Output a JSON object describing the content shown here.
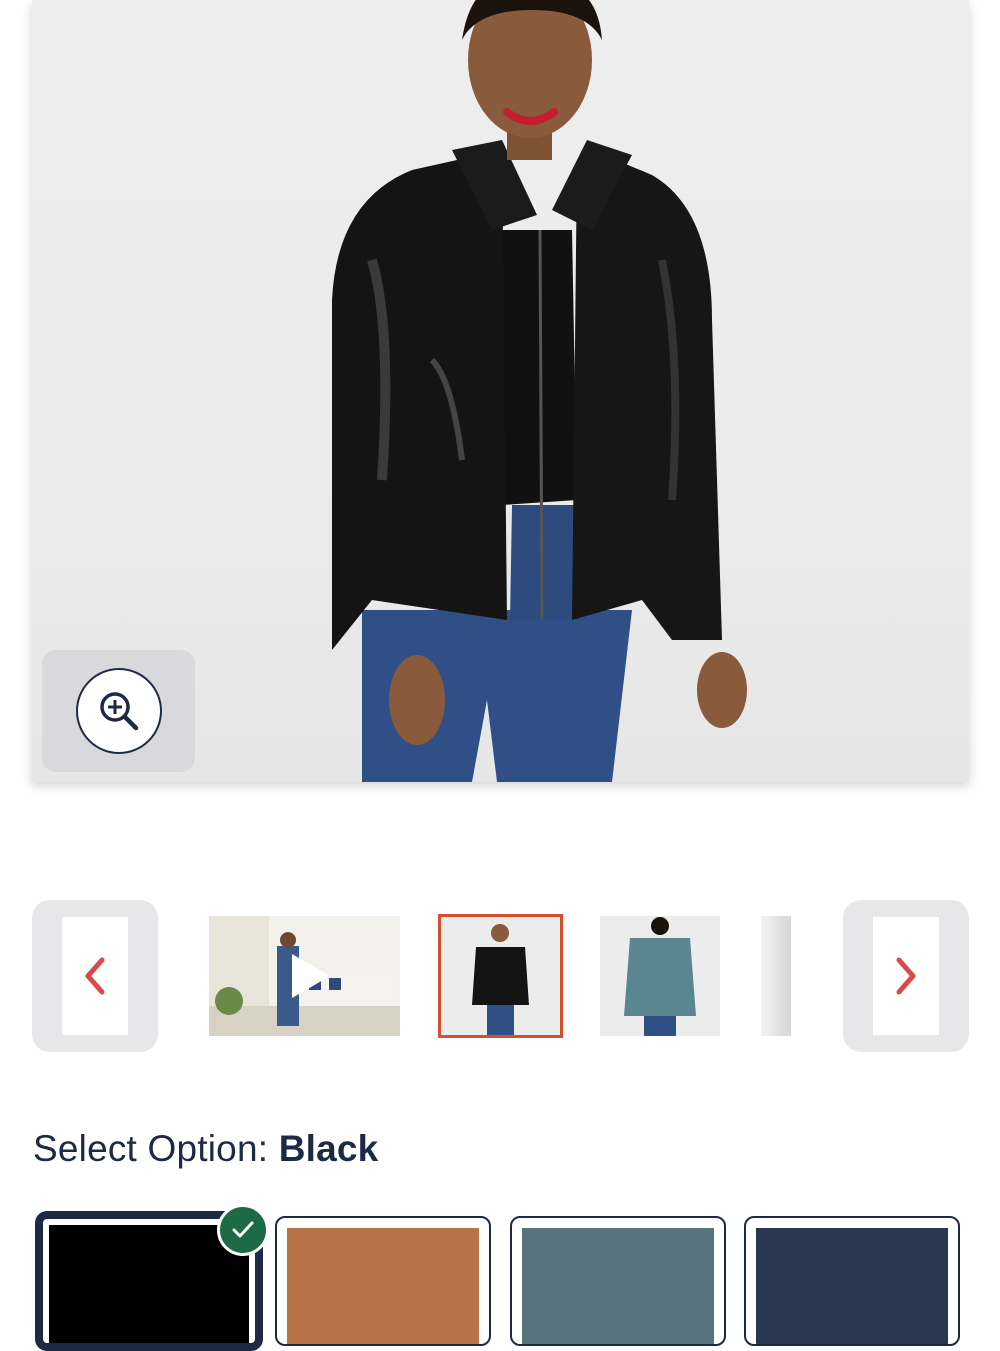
{
  "product_image": {
    "alt": "Woman wearing black leather zip jacket with jeans"
  },
  "zoom": {
    "icon": "zoom-in-icon"
  },
  "carousel": {
    "prev_icon": "chevron-left-icon",
    "next_icon": "chevron-right-icon",
    "accent": "#d94a4a",
    "thumbnails": [
      {
        "kind": "video",
        "icon": "play-icon"
      },
      {
        "kind": "image",
        "selected": true
      },
      {
        "kind": "image"
      },
      {
        "kind": "image"
      }
    ],
    "selected_border": "#d2502c"
  },
  "option": {
    "label": "Select Option:",
    "value": "Black"
  },
  "swatches": [
    {
      "color": "#000000",
      "selected": true,
      "badge_icon": "checkmark-icon"
    },
    {
      "color": "#b97247"
    },
    {
      "color": "#57737b"
    },
    {
      "color": "#2b3650"
    }
  ],
  "badge_color": "#1c6b45"
}
